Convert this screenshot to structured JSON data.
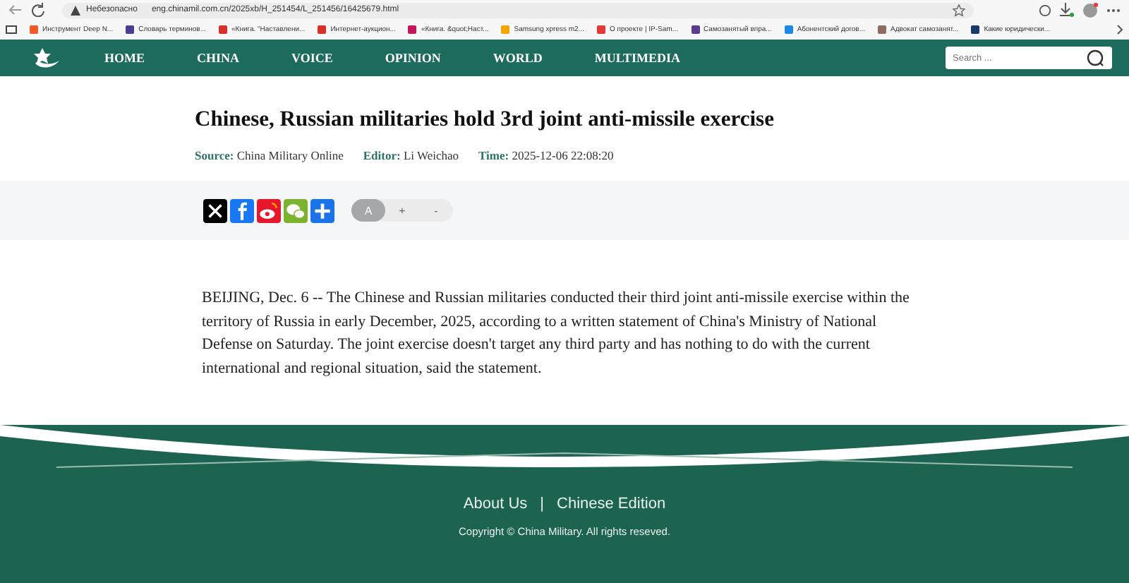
{
  "browser": {
    "security_label": "Небезопасно",
    "url": "eng.chinamil.com.cn/2025xb/H_251454/L_251456/16425679.html",
    "bookmarks": [
      {
        "label": "Инструмент Deep N...",
        "color": "#f05a28"
      },
      {
        "label": "Словарь терминов...",
        "color": "#4a3f8f"
      },
      {
        "label": "«Книга. \"Наставлени...",
        "color": "#d9302c"
      },
      {
        "label": "Интернет-аукцион...",
        "color": "#d9302c"
      },
      {
        "label": "«Книга. &quot;Наст...",
        "color": "#c2185b"
      },
      {
        "label": "Samsung xpress m2...",
        "color": "#f5a500"
      },
      {
        "label": "О проекте | IP-Sam...",
        "color": "#e53935"
      },
      {
        "label": "Самозанятый впра...",
        "color": "#5b3b8c"
      },
      {
        "label": "Абонентский догов...",
        "color": "#1e88e5"
      },
      {
        "label": "Адвокат самозанят...",
        "color": "#8d6e63"
      },
      {
        "label": "Какие юридически...",
        "color": "#1a3a6b"
      }
    ]
  },
  "nav": {
    "items": [
      {
        "label": "HOME"
      },
      {
        "label": "CHINA"
      },
      {
        "label": "VOICE"
      },
      {
        "label": "OPINION"
      },
      {
        "label": "WORLD"
      },
      {
        "label": "MULTIMEDIA"
      }
    ],
    "search": {
      "placeholder": "Search ..."
    }
  },
  "article": {
    "title": "Chinese, Russian militaries hold 3rd joint anti-missile exercise",
    "meta": [
      {
        "label": "Source:",
        "value": "China Military Online"
      },
      {
        "label": "Editor:",
        "value": "Li Weichao"
      },
      {
        "label": "Time:",
        "value": "2025-12-06 22:08:20"
      }
    ],
    "share": [
      {
        "kind": "x"
      },
      {
        "kind": "facebook"
      },
      {
        "kind": "weibo"
      },
      {
        "kind": "wechat"
      },
      {
        "kind": "more"
      }
    ],
    "font_controls": [
      "A",
      "+",
      "-"
    ],
    "body": "BEIJING, Dec. 6 -- The Chinese and Russian militaries conducted their third joint anti-missile exercise within the territory of Russia in early December, 2025, according to a written statement of China's Ministry of National Defense on Saturday. The joint exercise doesn't target any third party and has nothing to do with the current international and regional situation, said the statement."
  },
  "footer": {
    "links": [
      "About Us",
      "Chinese Edition"
    ],
    "separator": "|",
    "copyright": "Copyright © China Military. All rights reseved."
  }
}
